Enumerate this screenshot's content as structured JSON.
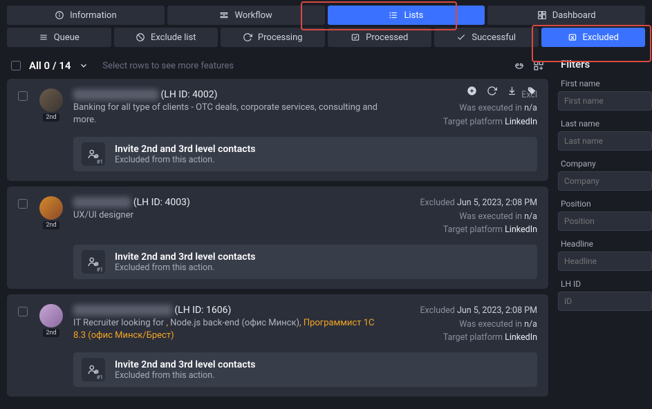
{
  "tabs1": [
    {
      "icon": "info-icon",
      "label": "Information",
      "selected": false
    },
    {
      "icon": "workflow-icon",
      "label": "Workflow",
      "selected": false
    },
    {
      "icon": "lists-icon",
      "label": "Lists",
      "selected": true
    },
    {
      "icon": "dashboard-icon",
      "label": "Dashboard",
      "selected": false
    }
  ],
  "tabs2": [
    {
      "icon": "queue-icon",
      "label": "Queue",
      "selected": false
    },
    {
      "icon": "exclude-icon",
      "label": "Exclude list",
      "selected": false
    },
    {
      "icon": "processing-icon",
      "label": "Processing",
      "selected": false
    },
    {
      "icon": "processed-icon",
      "label": "Processed",
      "selected": false
    },
    {
      "icon": "success-icon",
      "label": "Successful",
      "selected": false
    },
    {
      "icon": "excluded-icon",
      "label": "Excluded",
      "selected": true
    }
  ],
  "toolbar": {
    "all_label": "All 0 / 14",
    "hint": "Select rows to see more features"
  },
  "cards": [
    {
      "name_hidden": "████████████",
      "lhid": "(LH ID: 4002)",
      "degree": "2nd",
      "headline_parts": [
        {
          "t": "Banking for all type of clients - OTC deals, corporate services, consulting and more.",
          "o": false
        }
      ],
      "excluded_label": "Excl",
      "excluded_value": "",
      "executed_label": "Was executed in",
      "executed_value": "n/a",
      "platform_label": "Target platform",
      "platform_value": "LinkedIn",
      "show_row_icons": true,
      "action_title": "Invite 2nd and 3rd level contacts",
      "action_sub": "Excluded from this action.",
      "action_num": "#1"
    },
    {
      "name_hidden": "████████",
      "lhid": "(LH ID: 4003)",
      "degree": "2nd",
      "headline_parts": [
        {
          "t": "UX/UI designer",
          "o": false
        }
      ],
      "excluded_label": "Excluded",
      "excluded_value": "Jun 5, 2023, 2:08 PM",
      "executed_label": "Was executed in",
      "executed_value": "n/a",
      "platform_label": "Target platform",
      "platform_value": "LinkedIn",
      "show_row_icons": false,
      "action_title": "Invite 2nd and 3rd level contacts",
      "action_sub": "Excluded from this action.",
      "action_num": "#1"
    },
    {
      "name_hidden": "██████████████",
      "lhid": "(LH ID: 1606)",
      "degree": "2nd",
      "headline_parts": [
        {
          "t": "IT Recruiter looking for ",
          "o": false
        },
        {
          "t": ",",
          "o": true
        },
        {
          "t": " Node.js back-end (офис Минск)",
          "o": false
        },
        {
          "t": ",",
          "o": true
        },
        {
          "t": " ",
          "o": false
        },
        {
          "t": "Программист 1С 8.3 (",
          "o": true
        },
        {
          "t": "офис Минск/Брест",
          "o": true
        },
        {
          "t": ")",
          "o": true
        }
      ],
      "excluded_label": "Excluded",
      "excluded_value": "Jun 5, 2023, 2:08 PM",
      "executed_label": "Was executed in",
      "executed_value": "n/a",
      "platform_label": "Target platform",
      "platform_value": "LinkedIn",
      "show_row_icons": false,
      "action_title": "Invite 2nd and 3rd level contacts",
      "action_sub": "Excluded from this action.",
      "action_num": "#1"
    }
  ],
  "filters": {
    "title": "Filters",
    "fields": [
      {
        "label": "First name",
        "placeholder": "First name"
      },
      {
        "label": "Last name",
        "placeholder": "Last name"
      },
      {
        "label": "Company",
        "placeholder": "Company"
      },
      {
        "label": "Position",
        "placeholder": "Position"
      },
      {
        "label": "Headline",
        "placeholder": "Headline"
      },
      {
        "label": "LH ID",
        "placeholder": "ID"
      }
    ]
  }
}
